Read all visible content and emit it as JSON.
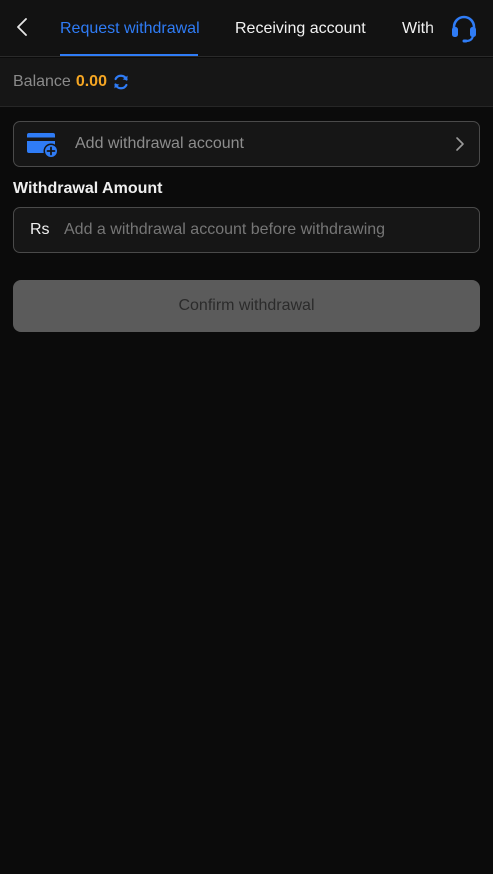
{
  "header": {
    "tabs": [
      {
        "label": "Request withdrawal",
        "active": true
      },
      {
        "label": "Receiving account",
        "active": false
      },
      {
        "label": "With",
        "active": false
      }
    ],
    "icons": {
      "back": "chevron-left-icon",
      "support": "headset-icon"
    }
  },
  "balance": {
    "label": "Balance",
    "value": "0.00",
    "refresh_icon": "refresh-icon"
  },
  "account": {
    "label": "Add withdrawal account",
    "icon": "add-card-icon",
    "chevron": "chevron-right-icon"
  },
  "amount": {
    "section_label": "Withdrawal Amount",
    "currency": "Rs",
    "placeholder": "Add a withdrawal account before withdrawing",
    "value": ""
  },
  "confirm": {
    "label": "Confirm withdrawal"
  },
  "colors": {
    "accent": "#2f7cf6",
    "balance": "#f5a623",
    "background": "#0b0b0b",
    "disabled_button": "#5b5b5b"
  }
}
